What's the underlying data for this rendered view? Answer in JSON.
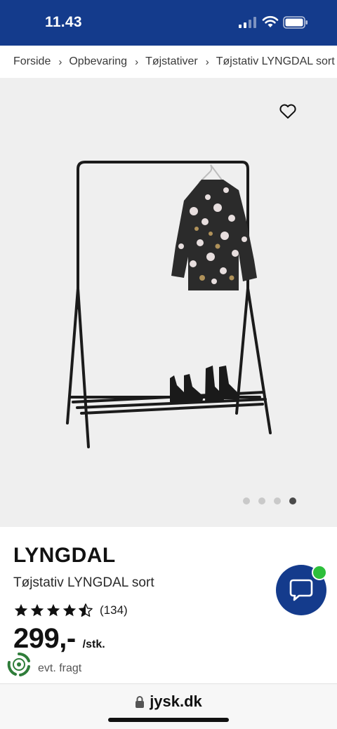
{
  "status_bar": {
    "time": "11.43",
    "icons": [
      "cellular-signal-icon",
      "wifi-icon",
      "battery-icon"
    ]
  },
  "breadcrumb": {
    "items": [
      "Forside",
      "Opbevaring",
      "Tøjstativer",
      "Tøjstativ LYNGDAL sort"
    ],
    "separator": "›"
  },
  "gallery": {
    "image_count": 4,
    "active_index": 3,
    "favorite_icon": "heart-outline-icon"
  },
  "product": {
    "brand": "LYNGDAL",
    "name": "Tøjstativ LYNGDAL sort",
    "rating_value": 4.5,
    "rating_max": 5,
    "review_count": "(134)",
    "price": "299,-",
    "unit": "/stk.",
    "shipping_note": "evt. fragt"
  },
  "chat": {
    "icon": "chat-bubble-icon",
    "status_color": "#2dbf3b"
  },
  "browser": {
    "url": "jysk.dk",
    "lock_icon": "lock-icon"
  },
  "colors": {
    "brand_blue": "#143b8c",
    "gallery_bg": "#efefef",
    "online_green": "#2dbf3b"
  }
}
